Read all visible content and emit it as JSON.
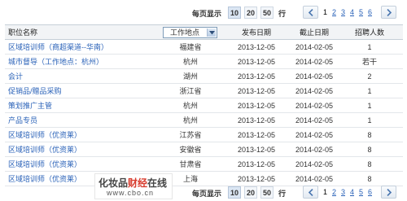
{
  "pager": {
    "per_page_label": "每页显示",
    "options": [
      "10",
      "20",
      "50"
    ],
    "selected": "10",
    "unit": "行",
    "pages": [
      "1",
      "2",
      "3",
      "4",
      "5",
      "6"
    ],
    "current_page": "1"
  },
  "table": {
    "headers": [
      "职位名称",
      "工作地点",
      "发布日期",
      "截止日期",
      "招聘人数"
    ],
    "rows": [
      [
        "区域培训师（商超渠道--华南）",
        "福建省",
        "2013-12-05",
        "2014-02-05",
        "1"
      ],
      [
        "城市督导（工作地点：杭州）",
        "杭州",
        "2013-12-05",
        "2014-02-05",
        "若干"
      ],
      [
        "会计",
        "湖州",
        "2013-12-05",
        "2014-02-05",
        "2"
      ],
      [
        "促销品/赠品采购",
        "浙江省",
        "2013-12-05",
        "2014-02-05",
        "1"
      ],
      [
        "策划推广主管",
        "杭州",
        "2013-12-05",
        "2014-02-05",
        "1"
      ],
      [
        "产品专员",
        "杭州",
        "2013-12-05",
        "2014-02-05",
        "1"
      ],
      [
        "区域培训师（优资莱）",
        "江苏省",
        "2013-12-05",
        "2014-02-05",
        "8"
      ],
      [
        "区域培训师（优资莱）",
        "安徽省",
        "2013-12-05",
        "2014-02-05",
        "8"
      ],
      [
        "区域培训师（优资莱）",
        "甘肃省",
        "2013-12-05",
        "2014-02-05",
        "8"
      ],
      [
        "区域培训师（优资莱）",
        "上海",
        "2013-12-05",
        "2014-02-05",
        "8"
      ]
    ]
  },
  "watermark": {
    "title_a": "化妆品",
    "title_b": "财经",
    "title_c": "在线",
    "url": "www.cbo.cn"
  },
  "colors": {
    "link": "#2a62b8",
    "header_bg": "#f2f4f6",
    "border": "#c6cfd8",
    "watermark_red": "#d83c2e"
  }
}
